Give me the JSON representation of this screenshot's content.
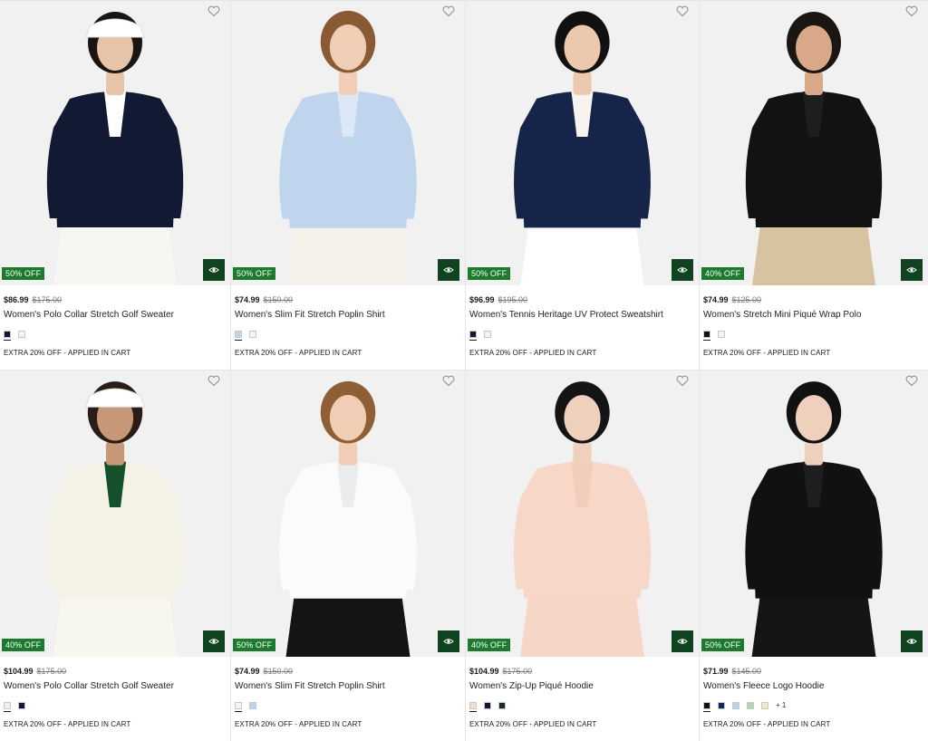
{
  "products": [
    {
      "discount": "50% OFF",
      "price": "$86.99",
      "original_price": "$175.00",
      "name": "Women's Polo Collar Stretch Golf Sweater",
      "swatches": [
        "#10183a",
        "#f2f2ee"
      ],
      "more": "",
      "promo": "EXTRA 20% OFF - APPLIED IN CART",
      "top": "#121a33",
      "bottom": "#f6f6f2",
      "accent": "#ffffff",
      "hair": "#1b1512",
      "skin": "#e7c4a8",
      "hat": "#ffffff"
    },
    {
      "discount": "50% OFF",
      "price": "$74.99",
      "original_price": "$150.00",
      "name": "Women's Slim Fit Stretch Poplin Shirt",
      "swatches": [
        "#bcd3ea",
        "#f4f4f2"
      ],
      "more": "",
      "promo": "EXTRA 20% OFF - APPLIED IN CART",
      "top": "#bfd5ee",
      "bottom": "#f3f1ea",
      "accent": "#dce8f5",
      "hair": "#8a5a33",
      "skin": "#f0cdb4",
      "hat": ""
    },
    {
      "discount": "50% OFF",
      "price": "$96.99",
      "original_price": "$195.00",
      "name": "Women's Tennis Heritage UV Protect Sweatshirt",
      "swatches": [
        "#0f1838",
        "#f2f2ee"
      ],
      "more": "",
      "promo": "EXTRA 20% OFF - APPLIED IN CART",
      "top": "#16244a",
      "bottom": "#ffffff",
      "accent": "#f5f4ef",
      "hair": "#111111",
      "skin": "#ecc9ae",
      "hat": ""
    },
    {
      "discount": "40% OFF",
      "price": "$74.99",
      "original_price": "$125.00",
      "name": "Women's Stretch Mini Piqué Wrap Polo",
      "swatches": [
        "#111111",
        "#f2f2ee"
      ],
      "more": "",
      "promo": "EXTRA 20% OFF - APPLIED IN CART",
      "top": "#121212",
      "bottom": "#d8c3a0",
      "accent": "#1e1e1e",
      "hair": "#1a1614",
      "skin": "#d8a888",
      "hat": ""
    },
    {
      "discount": "40% OFF",
      "price": "$104.99",
      "original_price": "$175.00",
      "name": "Women's Polo Collar Stretch Golf Sweater",
      "swatches": [
        "#f2f0e6",
        "#10183a"
      ],
      "more": "",
      "promo": "EXTRA 20% OFF - APPLIED IN CART",
      "top": "#f4f2e6",
      "bottom": "#f7f6ef",
      "accent": "#14502a",
      "hair": "#2a1d16",
      "skin": "#c79878",
      "hat": "#ffffff"
    },
    {
      "discount": "50% OFF",
      "price": "$74.99",
      "original_price": "$150.00",
      "name": "Women's Slim Fit Stretch Poplin Shirt",
      "swatches": [
        "#f4f4f2",
        "#bcd3ea"
      ],
      "more": "",
      "promo": "EXTRA 20% OFF - APPLIED IN CART",
      "top": "#fbfbfb",
      "bottom": "#141414",
      "accent": "#ececec",
      "hair": "#8e5e35",
      "skin": "#f0cdb4",
      "hat": ""
    },
    {
      "discount": "40% OFF",
      "price": "$104.99",
      "original_price": "$175.00",
      "name": "Women's Zip-Up Piqué Hoodie",
      "swatches": [
        "#f3dccd",
        "#10183a",
        "#1b2b26"
      ],
      "more": "",
      "promo": "EXTRA 20% OFF - APPLIED IN CART",
      "top": "#f7d8c8",
      "bottom": "#f6d6c6",
      "accent": "#f2cdbb",
      "hair": "#141414",
      "skin": "#efd0bc",
      "hat": ""
    },
    {
      "discount": "50% OFF",
      "price": "$71.99",
      "original_price": "$145.00",
      "name": "Women's Fleece Logo Hoodie",
      "swatches": [
        "#111111",
        "#10285a",
        "#b8d3ea",
        "#a8dcb0",
        "#f3eab8"
      ],
      "more": "+ 1",
      "promo": "EXTRA 20% OFF - APPLIED IN CART",
      "top": "#111111",
      "bottom": "#151515",
      "accent": "#1e1e1e",
      "hair": "#111111",
      "skin": "#efd0bc",
      "hat": ""
    }
  ],
  "colors": {
    "badge": "#1c7a2c",
    "quickview": "#10431f"
  }
}
